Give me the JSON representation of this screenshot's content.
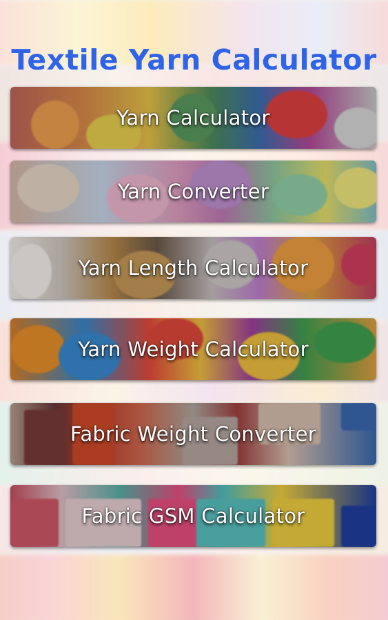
{
  "app": {
    "title": "Textile Yarn Calculator"
  },
  "menu": {
    "items": [
      {
        "label": "Yarn Calculator"
      },
      {
        "label": "Yarn Converter"
      },
      {
        "label": "Yarn Length Calculator"
      },
      {
        "label": "Yarn Weight Calculator"
      },
      {
        "label": "Fabric Weight Converter"
      },
      {
        "label": "Fabric GSM Calculator"
      }
    ]
  },
  "colors": {
    "title": "#2f63e8",
    "label": "#ffffff"
  }
}
